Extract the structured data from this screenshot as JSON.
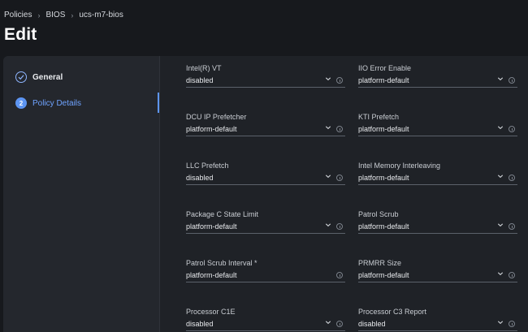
{
  "breadcrumb": {
    "items": [
      "Policies",
      "BIOS",
      "ucs-m7-bios"
    ],
    "separator": "›"
  },
  "page": {
    "title": "Edit"
  },
  "wizard": {
    "steps": [
      {
        "number": "✓",
        "label": "General",
        "state": "complete"
      },
      {
        "number": "2",
        "label": "Policy Details",
        "state": "active"
      }
    ]
  },
  "fields": [
    {
      "label": "Intel(R) VT",
      "value": "disabled",
      "dropdown": true
    },
    {
      "label": "IIO Error Enable",
      "value": "platform-default",
      "dropdown": true
    },
    {
      "label": "DCU IP Prefetcher",
      "value": "platform-default",
      "dropdown": true
    },
    {
      "label": "KTI Prefetch",
      "value": "platform-default",
      "dropdown": true
    },
    {
      "label": "LLC Prefetch",
      "value": "disabled",
      "dropdown": true
    },
    {
      "label": "Intel Memory Interleaving",
      "value": "platform-default",
      "dropdown": true
    },
    {
      "label": "Package C State Limit",
      "value": "platform-default",
      "dropdown": true
    },
    {
      "label": "Patrol Scrub",
      "value": "platform-default",
      "dropdown": true
    },
    {
      "label": "Patrol Scrub Interval *",
      "value": "platform-default",
      "dropdown": false
    },
    {
      "label": "PRMRR Size",
      "value": "platform-default",
      "dropdown": true
    },
    {
      "label": "Processor C1E",
      "value": "disabled",
      "dropdown": true
    },
    {
      "label": "Processor C3 Report",
      "value": "disabled",
      "dropdown": true
    }
  ],
  "icons": {
    "info": "info-icon",
    "chevron": "chevron-down-icon",
    "check": "check-icon"
  },
  "colors": {
    "accent": "#5d95f2",
    "background": "#17191d",
    "panel": "#1f2227"
  }
}
